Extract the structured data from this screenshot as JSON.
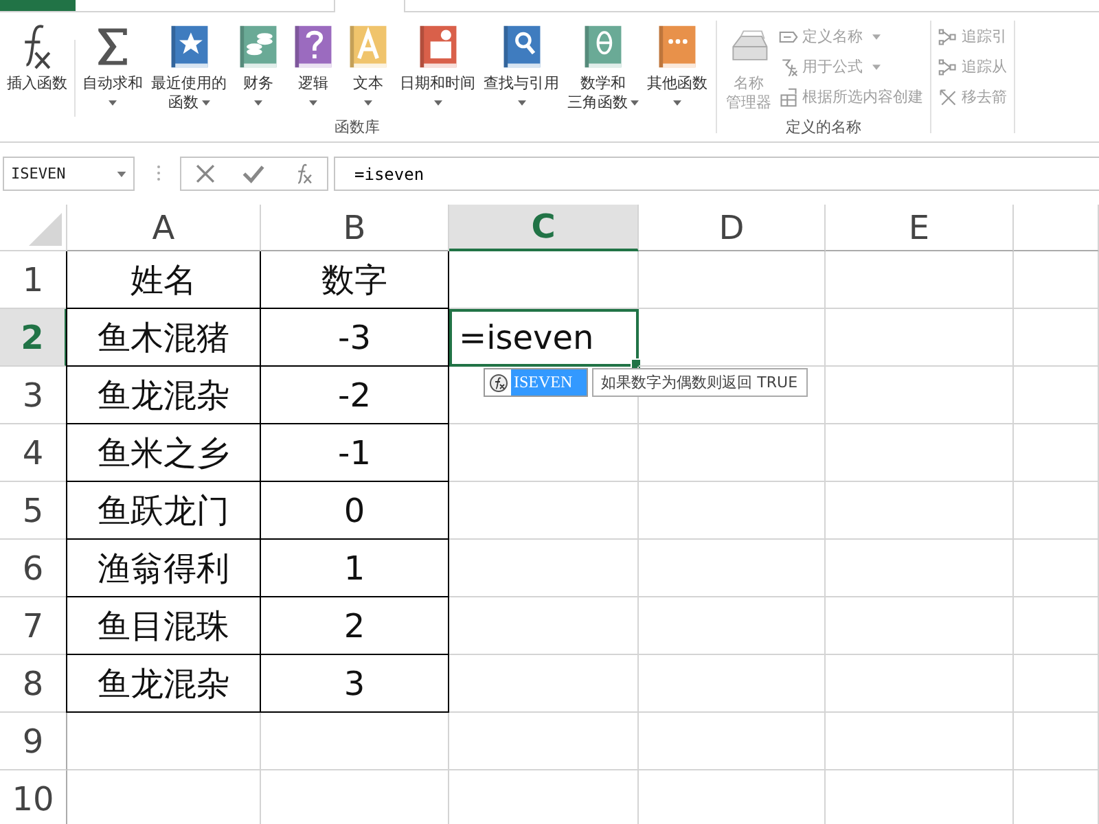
{
  "ribbon": {
    "groups": [
      {
        "label": "函数库",
        "disabled": false,
        "buttons": [
          {
            "kind": "fx",
            "lines": [
              "插入函数"
            ],
            "dropdown": false
          },
          {
            "kind": "sigma",
            "lines": [
              "自动求和"
            ],
            "dropdown": true
          },
          {
            "kind": "star",
            "lines": [
              "最近使用的",
              "函数"
            ],
            "dropdown": true
          },
          {
            "kind": "coins",
            "lines": [
              "财务"
            ],
            "dropdown": true
          },
          {
            "kind": "question",
            "lines": [
              "逻辑"
            ],
            "dropdown": true
          },
          {
            "kind": "letter",
            "lines": [
              "文本"
            ],
            "dropdown": true
          },
          {
            "kind": "calendar",
            "lines": [
              "日期和时间"
            ],
            "dropdown": true
          },
          {
            "kind": "search",
            "lines": [
              "查找与引用"
            ],
            "dropdown": true
          },
          {
            "kind": "theta",
            "lines": [
              "数学和",
              "三角函数"
            ],
            "dropdown": true
          },
          {
            "kind": "dots",
            "lines": [
              "其他函数"
            ],
            "dropdown": true
          }
        ]
      },
      {
        "label": "定义的名称",
        "disabled": true,
        "buttons": [
          {
            "kind": "names",
            "lines": [
              "名称",
              "管理器"
            ],
            "dropdown": false
          }
        ],
        "small_buttons": [
          {
            "kind": "tag",
            "label": "定义名称",
            "dropdown": true
          },
          {
            "kind": "fx-small",
            "label": "用于公式",
            "dropdown": true
          },
          {
            "kind": "grid",
            "label": "根据所选内容创建",
            "dropdown": false
          }
        ]
      },
      {
        "disabled": true,
        "small_buttons": [
          {
            "kind": "trace",
            "label": "追踪引",
            "dropdown": false
          },
          {
            "kind": "trace",
            "label": "追踪从",
            "dropdown": false
          },
          {
            "kind": "remove",
            "label": "移去箭",
            "dropdown": false
          }
        ]
      }
    ]
  },
  "formula_bar": {
    "name_box": "ISEVEN",
    "formula": "=iseven"
  },
  "sheet": {
    "columns": [
      {
        "label": "A",
        "selected": false
      },
      {
        "label": "B",
        "selected": false
      },
      {
        "label": "C",
        "selected": true
      },
      {
        "label": "D",
        "selected": false
      },
      {
        "label": "E",
        "selected": false
      }
    ],
    "rows": [
      {
        "number": "1",
        "selected": false,
        "cells": [
          {
            "text": "姓名",
            "bordered": true,
            "selected": false
          },
          {
            "text": "数字",
            "bordered": true,
            "selected": false
          }
        ]
      },
      {
        "number": "2",
        "selected": true,
        "cells": [
          {
            "text": "鱼木混猪",
            "bordered": true,
            "selected": false
          },
          {
            "text": "-3",
            "bordered": true,
            "selected": false
          },
          {
            "text": "=iseven",
            "bordered": false,
            "selected": true
          }
        ]
      },
      {
        "number": "3",
        "selected": false,
        "cells": [
          {
            "text": "鱼龙混杂",
            "bordered": true,
            "selected": false
          },
          {
            "text": "-2",
            "bordered": true,
            "selected": false
          }
        ]
      },
      {
        "number": "4",
        "selected": false,
        "cells": [
          {
            "text": "鱼米之乡",
            "bordered": true,
            "selected": false
          },
          {
            "text": "-1",
            "bordered": true,
            "selected": false
          }
        ]
      },
      {
        "number": "5",
        "selected": false,
        "cells": [
          {
            "text": "鱼跃龙门",
            "bordered": true,
            "selected": false
          },
          {
            "text": "0",
            "bordered": true,
            "selected": false
          }
        ]
      },
      {
        "number": "6",
        "selected": false,
        "cells": [
          {
            "text": "渔翁得利",
            "bordered": true,
            "selected": false
          },
          {
            "text": "1",
            "bordered": true,
            "selected": false
          }
        ]
      },
      {
        "number": "7",
        "selected": false,
        "cells": [
          {
            "text": "鱼目混珠",
            "bordered": true,
            "selected": false
          },
          {
            "text": "2",
            "bordered": true,
            "selected": false
          }
        ]
      },
      {
        "number": "8",
        "selected": false,
        "cells": [
          {
            "text": "鱼龙混杂",
            "bordered": true,
            "selected": false
          },
          {
            "text": "3",
            "bordered": true,
            "selected": false
          }
        ]
      },
      {
        "number": "9",
        "selected": false,
        "cells": []
      },
      {
        "number": "10",
        "selected": false,
        "cells": []
      }
    ]
  },
  "autocomplete": {
    "items": [
      {
        "label": "ISEVEN",
        "selected": true
      }
    ],
    "tooltip": "如果数字为偶数则返回 TRUE"
  }
}
